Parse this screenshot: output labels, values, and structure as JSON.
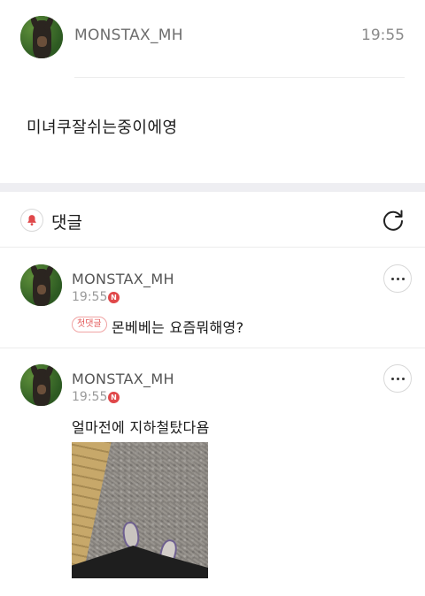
{
  "post": {
    "author": "MONSTAX_MH",
    "time": "19:55",
    "body": "미녀쿠잘쉬는중이에영"
  },
  "comments_header": {
    "title": "댓글",
    "bell_icon": "bell-icon",
    "refresh_icon": "refresh-icon"
  },
  "comments": [
    {
      "author": "MONSTAX_MH",
      "time": "19:55",
      "new_badge": "N",
      "first_comment_badge": "첫댓글",
      "text": "몬베베는 요즘뭐해영?"
    },
    {
      "author": "MONSTAX_MH",
      "time": "19:55",
      "new_badge": "N",
      "text": "얼마전에 지하철탔다욤",
      "has_photo": true
    }
  ],
  "colors": {
    "accent_red": "#e0484a",
    "muted_text": "#8a8a8a",
    "divider": "#ececec"
  }
}
